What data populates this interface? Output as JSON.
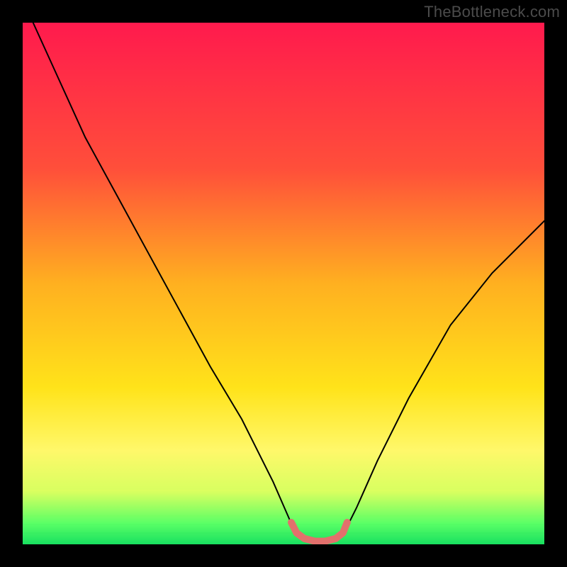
{
  "watermark": "TheBottleneck.com",
  "colors": {
    "frame": "#000000",
    "gradient_stops": [
      {
        "offset": 0.0,
        "color": "#ff1a4d"
      },
      {
        "offset": 0.28,
        "color": "#ff4f3a"
      },
      {
        "offset": 0.5,
        "color": "#ffb020"
      },
      {
        "offset": 0.7,
        "color": "#ffe31a"
      },
      {
        "offset": 0.82,
        "color": "#fff86a"
      },
      {
        "offset": 0.9,
        "color": "#d7ff60"
      },
      {
        "offset": 0.96,
        "color": "#5aff66"
      },
      {
        "offset": 1.0,
        "color": "#18e060"
      }
    ],
    "curve": "#000000",
    "optimal_marker": "#e2706c"
  },
  "chart_data": {
    "type": "line",
    "title": "",
    "xlabel": "",
    "ylabel": "",
    "xlim": [
      0,
      100
    ],
    "ylim": [
      0,
      100
    ],
    "grid": false,
    "legend": null,
    "series": [
      {
        "name": "bottleneck-curve",
        "x": [
          2,
          7,
          12,
          18,
          24,
          30,
          36,
          42,
          48,
          51.5,
          54,
          56,
          58,
          60,
          62,
          64,
          68,
          74,
          82,
          90,
          100
        ],
        "y": [
          100,
          89,
          78,
          67,
          56,
          45,
          34,
          24,
          12,
          4,
          1,
          0.5,
          0.5,
          1,
          3,
          7,
          16,
          28,
          42,
          52,
          62
        ]
      }
    ],
    "annotations": [
      {
        "name": "optimal-range-marker",
        "type": "polyline",
        "x": [
          51.5,
          52.5,
          54,
          56,
          58,
          60,
          61.4,
          62.2
        ],
        "y": [
          4.2,
          2.2,
          1.1,
          0.6,
          0.6,
          1.1,
          2.2,
          4.2
        ],
        "stroke_width_px": 10,
        "color_ref": "optimal_marker"
      }
    ]
  }
}
